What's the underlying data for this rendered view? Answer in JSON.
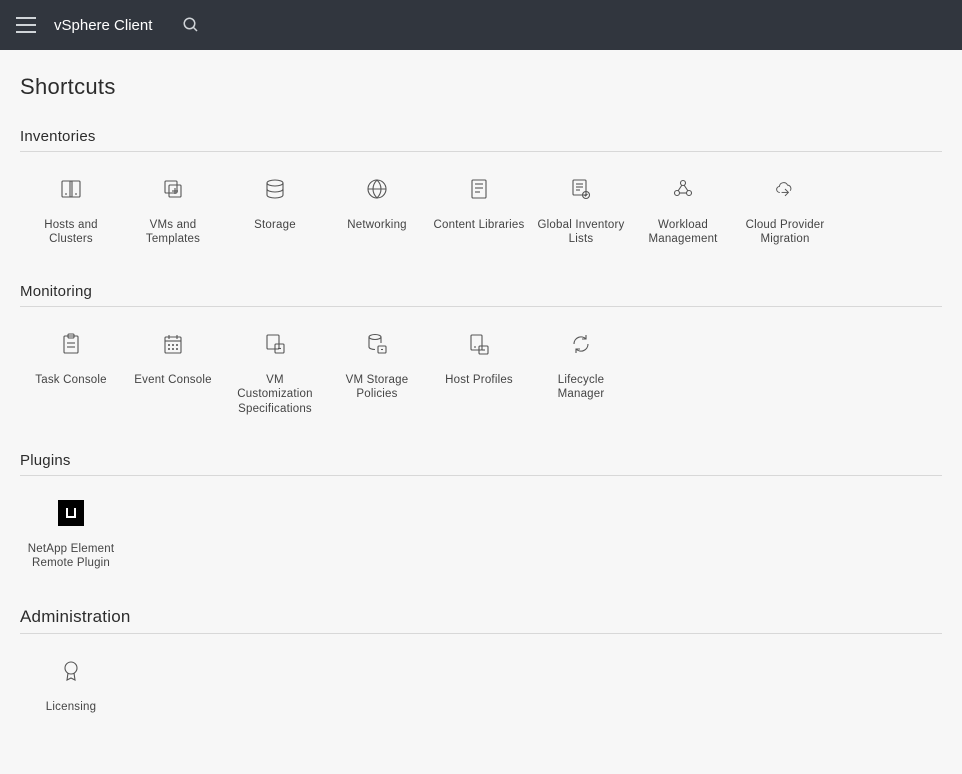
{
  "header": {
    "app_title": "vSphere Client"
  },
  "page_title": "Shortcuts",
  "sections": {
    "inventories": {
      "title": "Inventories",
      "items": [
        {
          "label": "Hosts and Clusters",
          "icon": "hosts-clusters-icon"
        },
        {
          "label": "VMs and Templates",
          "icon": "vms-templates-icon"
        },
        {
          "label": "Storage",
          "icon": "storage-icon"
        },
        {
          "label": "Networking",
          "icon": "networking-icon"
        },
        {
          "label": "Content Libraries",
          "icon": "content-libraries-icon"
        },
        {
          "label": "Global Inventory Lists",
          "icon": "global-inventory-icon"
        },
        {
          "label": "Workload Management",
          "icon": "workload-management-icon"
        },
        {
          "label": "Cloud Provider Migration",
          "icon": "cloud-migration-icon"
        }
      ]
    },
    "monitoring": {
      "title": "Monitoring",
      "items": [
        {
          "label": "Task Console",
          "icon": "task-console-icon"
        },
        {
          "label": "Event Console",
          "icon": "event-console-icon"
        },
        {
          "label": "VM Customization Specifications",
          "icon": "vm-customization-icon"
        },
        {
          "label": "VM Storage Policies",
          "icon": "vm-storage-policies-icon"
        },
        {
          "label": "Host Profiles",
          "icon": "host-profiles-icon"
        },
        {
          "label": "Lifecycle Manager",
          "icon": "lifecycle-manager-icon"
        }
      ]
    },
    "plugins": {
      "title": "Plugins",
      "items": [
        {
          "label": "NetApp Element Remote Plugin",
          "icon": "netapp-plugin-icon"
        }
      ]
    },
    "administration": {
      "title": "Administration",
      "items": [
        {
          "label": "Licensing",
          "icon": "licensing-icon"
        }
      ]
    }
  }
}
